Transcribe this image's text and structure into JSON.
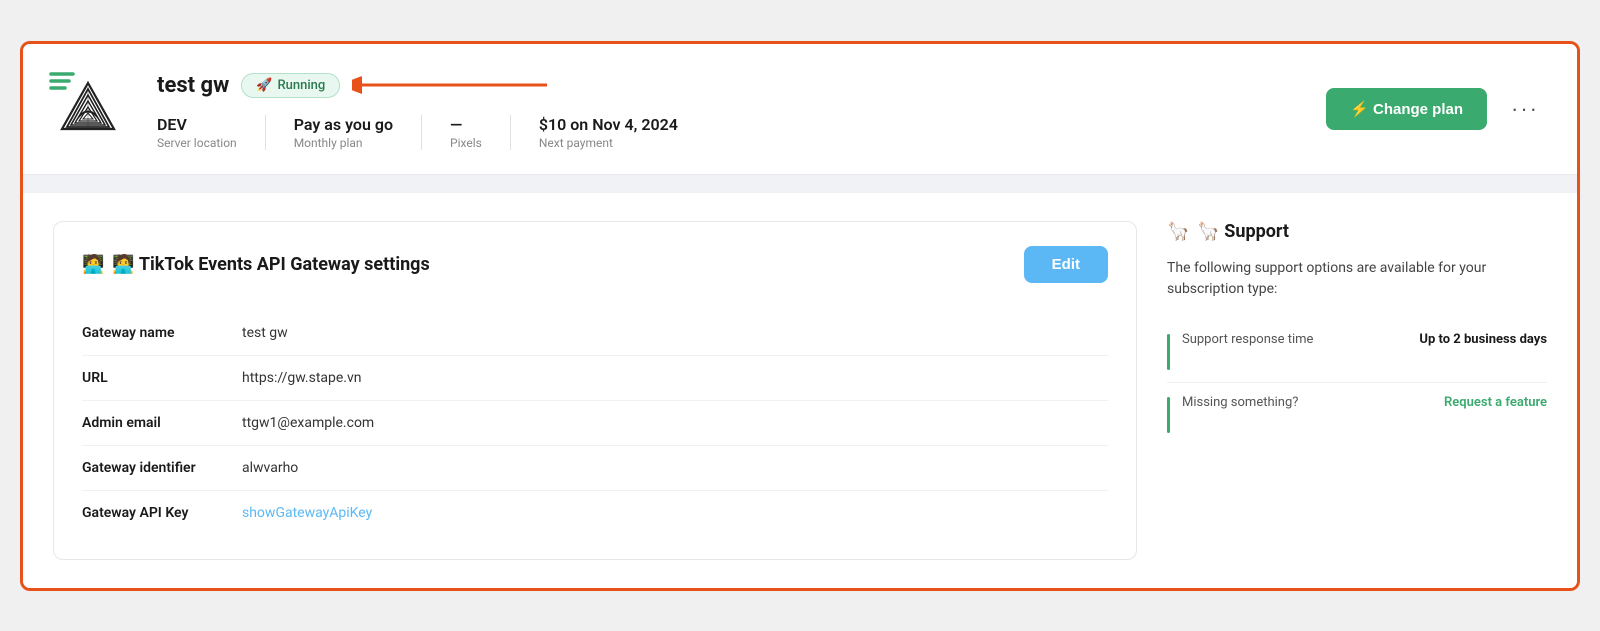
{
  "header": {
    "gateway_name": "test gw",
    "status_label": "Running",
    "status_emoji": "🚀",
    "meta": [
      {
        "value": "DEV",
        "label": "Server location"
      },
      {
        "value": "Pay as you go",
        "label": "Monthly plan"
      },
      {
        "value": "—",
        "label": "Pixels"
      },
      {
        "value": "$10 on Nov 4, 2024",
        "label": "Next payment"
      }
    ],
    "change_plan_label": "⚡ Change plan",
    "more_label": "···"
  },
  "settings_panel": {
    "title": "🧑‍💻 TikTok Events API Gateway settings",
    "edit_label": "Edit",
    "fields": [
      {
        "key": "Gateway name",
        "value": "test gw",
        "type": "text"
      },
      {
        "key": "URL",
        "value": "https://gw.stape.vn",
        "type": "text"
      },
      {
        "key": "Admin email",
        "value": "ttgw1@example.com",
        "type": "text"
      },
      {
        "key": "Gateway identifier",
        "value": "alwvarho",
        "type": "text"
      },
      {
        "key": "Gateway API Key",
        "value": "showGatewayApiKey",
        "type": "link"
      }
    ]
  },
  "support_panel": {
    "title": "🦙 Support",
    "description": "The following support options are available for your subscription type:",
    "items": [
      {
        "label": "Support response time",
        "value": "Up to 2 business days",
        "type": "text"
      },
      {
        "label": "Missing something?",
        "value": "Request a feature",
        "type": "link"
      }
    ]
  }
}
